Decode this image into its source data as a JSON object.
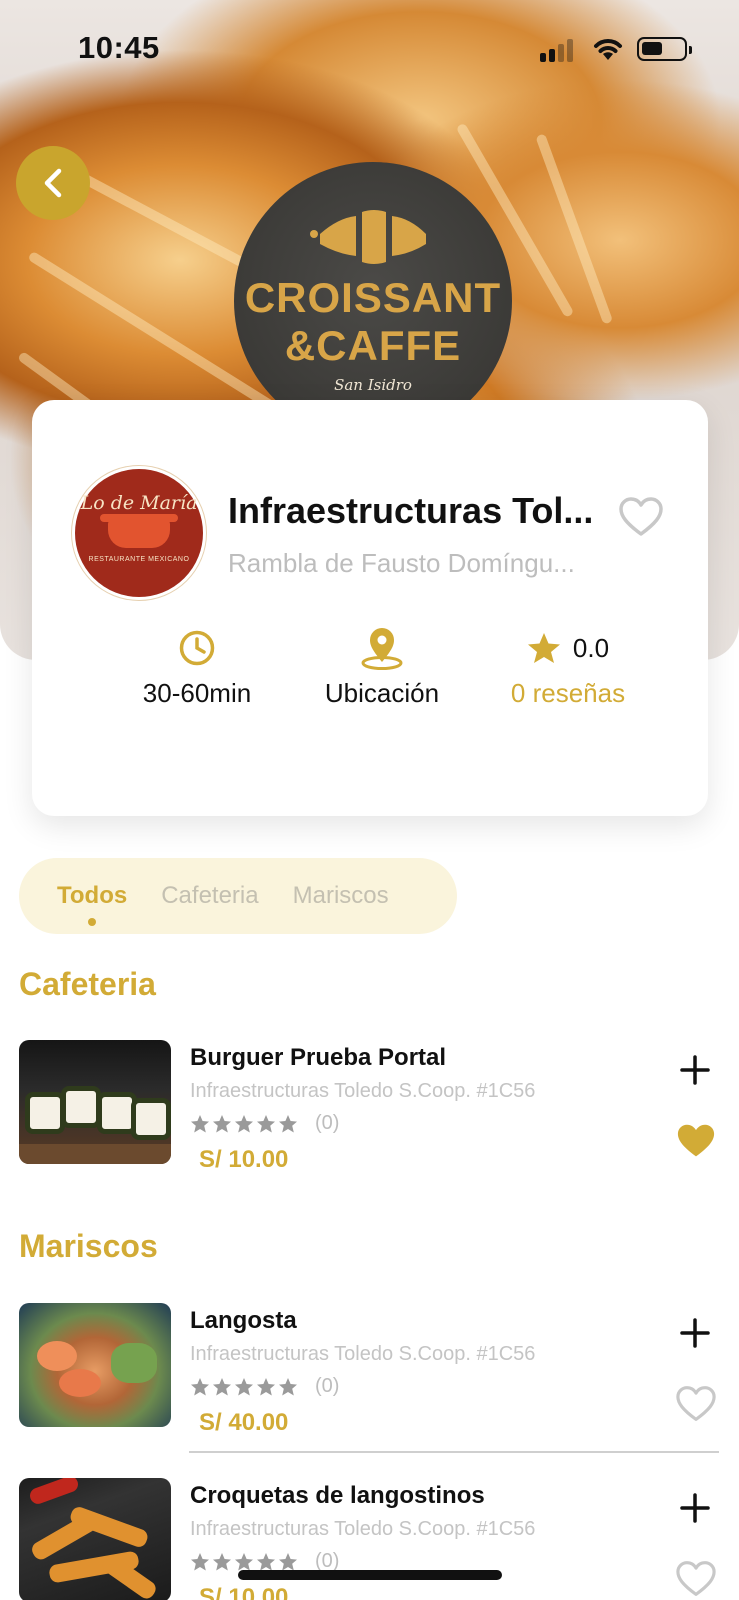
{
  "status_bar": {
    "time": "10:45"
  },
  "hero": {
    "brand_line1": "CROISSANT",
    "brand_line2": "&CAFFE",
    "brand_line3": "San Isidro"
  },
  "restaurant": {
    "logo_script": "Lo de María",
    "logo_tagline": "RESTAURANTE MEXICANO",
    "name": "Infraestructuras Tol...",
    "address": "Rambla de Fausto Domíngu...",
    "delivery_time": "30-60min",
    "location_label": "Ubicación",
    "rating_value": "0.0",
    "reviews_label": "0 reseñas"
  },
  "tabs": [
    {
      "label": "Todos",
      "active": true
    },
    {
      "label": "Cafeteria",
      "active": false
    },
    {
      "label": "Mariscos",
      "active": false
    }
  ],
  "sections": [
    {
      "title": "Cafeteria",
      "products": [
        {
          "name": "Burguer Prueba Portal",
          "vendor": "Infraestructuras Toledo S.Coop. #1C56",
          "reviews": "(0)",
          "price": "S/ 10.00",
          "favorite": true
        }
      ]
    },
    {
      "title": "Mariscos",
      "products": [
        {
          "name": "Langosta",
          "vendor": "Infraestructuras Toledo S.Coop. #1C56",
          "reviews": "(0)",
          "price": "S/ 40.00",
          "favorite": false
        },
        {
          "name": "Croquetas de langostinos",
          "vendor": "Infraestructuras Toledo S.Coop. #1C56",
          "reviews": "(0)",
          "price": "S/ 10.00",
          "favorite": false
        }
      ]
    }
  ],
  "colors": {
    "accent": "#d2ab36",
    "back_button": "#c9a52d",
    "tab_bg": "#faf4dc",
    "muted_text": "#bdbdbd"
  },
  "icons": [
    "chevron-left-icon",
    "heart-outline-icon",
    "clock-icon",
    "location-pin-icon",
    "star-icon",
    "plus-icon",
    "heart-filled-icon"
  ]
}
